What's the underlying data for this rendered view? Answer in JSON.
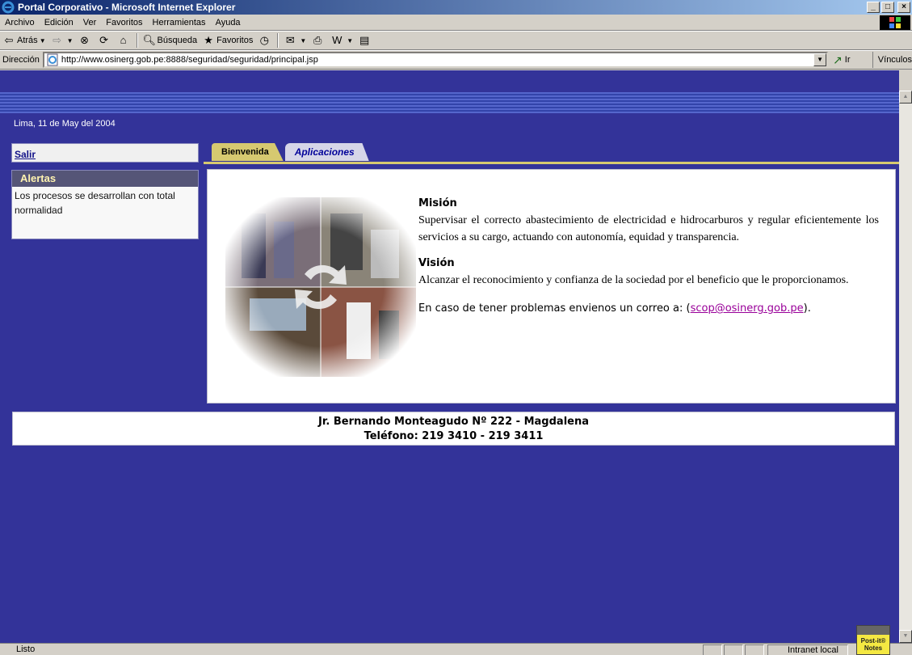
{
  "window": {
    "title": "Portal Corporativo - Microsoft Internet Explorer",
    "controls": [
      "_",
      "□",
      "×"
    ]
  },
  "menu": [
    "Archivo",
    "Edición",
    "Ver",
    "Favoritos",
    "Herramientas",
    "Ayuda"
  ],
  "toolbar": {
    "back_label": "Atrás",
    "search_label": "Búsqueda",
    "favorites_label": "Favoritos"
  },
  "address": {
    "label": "Dirección",
    "url": "http://www.osinerg.gob.pe:8888/seguridad/seguridad/principal.jsp",
    "go_label": "Ir",
    "links_label": "Vínculos"
  },
  "page": {
    "date": "Lima, 11 de May del 2004",
    "logout_link": "Salir",
    "alerts": {
      "title": "Alertas",
      "text": "Los procesos se desarrollan con total normalidad"
    },
    "tabs": [
      {
        "label": "Bienvenida",
        "active": true
      },
      {
        "label": "Aplicaciones",
        "active": false
      }
    ],
    "mission": {
      "title": "Misión",
      "text": "Supervisar el correcto abastecimiento de electricidad e hidrocarburos y regular eficientemente los servicios a su cargo, actuando con autonomía, equidad y transparencia."
    },
    "vision": {
      "title": "Visión",
      "text": "Alcanzar el reconocimiento y confianza de la sociedad por el beneficio que le proporcionamos."
    },
    "contact": {
      "prefix": "En caso de tener problemas envienos un correo a: (",
      "email": "scop@osinerg.gob.pe",
      "suffix": ")."
    },
    "footer": {
      "address": "Jr. Bernando Monteagudo Nº 222 - Magdalena",
      "phone": "Teléfono: 219 3410 - 219 3411"
    }
  },
  "status": {
    "text": "Listo",
    "zone": "Intranet local",
    "postit": "Post-it® Notes"
  },
  "colors": {
    "page_background": "#333399",
    "tab_active": "#d6c970",
    "alerts_header": "#555577"
  }
}
